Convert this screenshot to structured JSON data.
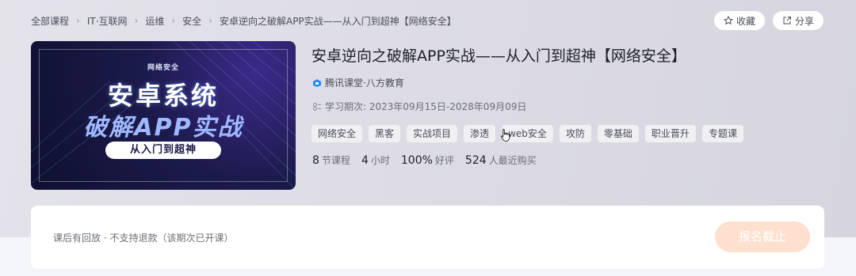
{
  "breadcrumb": [
    "全部课程",
    "IT·互联网",
    "运维",
    "安全",
    "安卓逆向之破解APP实战——从入门到超神【网络安全】"
  ],
  "actions": {
    "favorite": "收藏",
    "share": "分享"
  },
  "cover": {
    "badge": "网络安全",
    "line1": "安卓系统",
    "line2": "破解APP实战",
    "pill": "从入门到超神"
  },
  "course": {
    "title": "安卓逆向之破解APP实战——从入门到超神【网络安全】",
    "provider": "腾讯课堂·八方教育",
    "period": "学习期次: 2023年09月15日-2028年09月09日",
    "tags": [
      "网络安全",
      "黑客",
      "实战项目",
      "渗透",
      "web安全",
      "攻防",
      "零基础",
      "职业晋升",
      "专题课"
    ],
    "stats": {
      "lessons_value": "8",
      "lessons_unit": "节课程",
      "hours_value": "4",
      "hours_unit": "小时",
      "rating_value": "100%",
      "rating_unit": "好评",
      "buyers_value": "524",
      "buyers_unit": "人最近购买"
    }
  },
  "bottom": {
    "note": "课后有回放 · 不支持退款（该期次已开课）",
    "enroll_button": "报名截止"
  },
  "colors": {
    "accent": "#ff7a3c",
    "enroll_disabled": "#ffe0cf",
    "provider_icon": "#1e8cff"
  }
}
